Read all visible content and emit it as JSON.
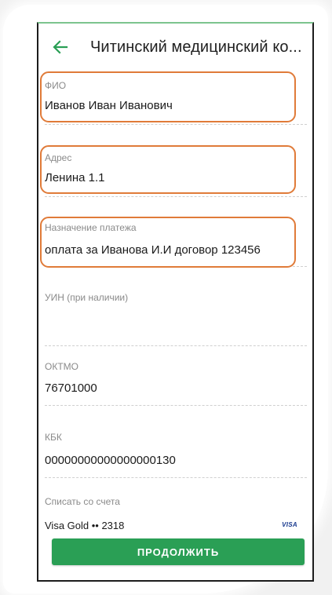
{
  "colors": {
    "accent": "#2a9f55",
    "highlight": "#e07b39",
    "label": "#8a8a8a",
    "text": "#1a1a1a"
  },
  "header": {
    "back_icon": "arrow-left-icon",
    "title": "Читинский медицинский ко..."
  },
  "fields": {
    "fio": {
      "label": "ФИО",
      "value": "Иванов Иван Иванович"
    },
    "address": {
      "label": "Адрес",
      "value": "Ленина 1.1"
    },
    "purpose": {
      "label": "Назначение платежа",
      "value": "оплата за Иванова И.И договор 123456"
    },
    "uin": {
      "label": "УИН (при наличии)",
      "value": ""
    },
    "oktmo": {
      "label": "ОКТМО",
      "value": "76701000"
    },
    "kbk": {
      "label": "КБК",
      "value": "00000000000000000130"
    }
  },
  "account": {
    "label": "Списать со счета",
    "name": "Visa Gold •• 2318",
    "icon": "visa-icon",
    "icon_text": "VISA"
  },
  "continue_label": "ПРОДОЛЖИТЬ"
}
